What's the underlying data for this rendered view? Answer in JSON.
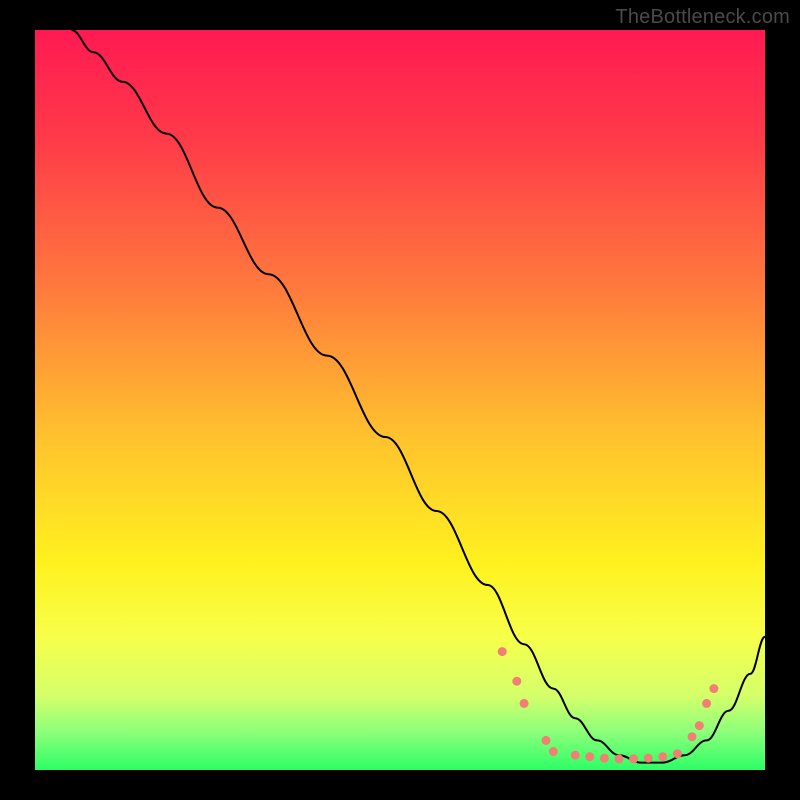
{
  "watermark": "TheBottleneck.com",
  "chart_data": {
    "type": "line",
    "title": "",
    "xlabel": "",
    "ylabel": "",
    "xlim": [
      0,
      100
    ],
    "ylim": [
      0,
      100
    ],
    "background_gradient": [
      {
        "offset": 0,
        "color": "#ff1a52"
      },
      {
        "offset": 0.15,
        "color": "#ff3b49"
      },
      {
        "offset": 0.35,
        "color": "#ff7a3d"
      },
      {
        "offset": 0.55,
        "color": "#ffc22e"
      },
      {
        "offset": 0.72,
        "color": "#fff11f"
      },
      {
        "offset": 0.82,
        "color": "#f7ff4a"
      },
      {
        "offset": 0.9,
        "color": "#d4ff6a"
      },
      {
        "offset": 0.95,
        "color": "#8aff7a"
      },
      {
        "offset": 1.0,
        "color": "#2cff66"
      }
    ],
    "series": [
      {
        "name": "curve",
        "x": [
          5,
          8,
          12,
          18,
          25,
          32,
          40,
          48,
          55,
          62,
          67,
          71,
          74,
          77,
          80,
          83,
          86,
          89,
          92,
          95,
          98,
          100
        ],
        "y": [
          100,
          97,
          93,
          86,
          76,
          67,
          56,
          45,
          35,
          25,
          17,
          11,
          7,
          4,
          2,
          1,
          1,
          2,
          4,
          8,
          13,
          18
        ]
      }
    ],
    "dotted_band": {
      "color": "#f08073",
      "radius": 4.5,
      "points": [
        {
          "x": 64,
          "y": 16
        },
        {
          "x": 66,
          "y": 12
        },
        {
          "x": 67,
          "y": 9
        },
        {
          "x": 70,
          "y": 4
        },
        {
          "x": 71,
          "y": 2.5
        },
        {
          "x": 74,
          "y": 2
        },
        {
          "x": 76,
          "y": 1.8
        },
        {
          "x": 78,
          "y": 1.6
        },
        {
          "x": 80,
          "y": 1.5
        },
        {
          "x": 82,
          "y": 1.5
        },
        {
          "x": 84,
          "y": 1.6
        },
        {
          "x": 86,
          "y": 1.8
        },
        {
          "x": 88,
          "y": 2.2
        },
        {
          "x": 90,
          "y": 4.5
        },
        {
          "x": 91,
          "y": 6
        },
        {
          "x": 92,
          "y": 9
        },
        {
          "x": 93,
          "y": 11
        }
      ]
    }
  }
}
